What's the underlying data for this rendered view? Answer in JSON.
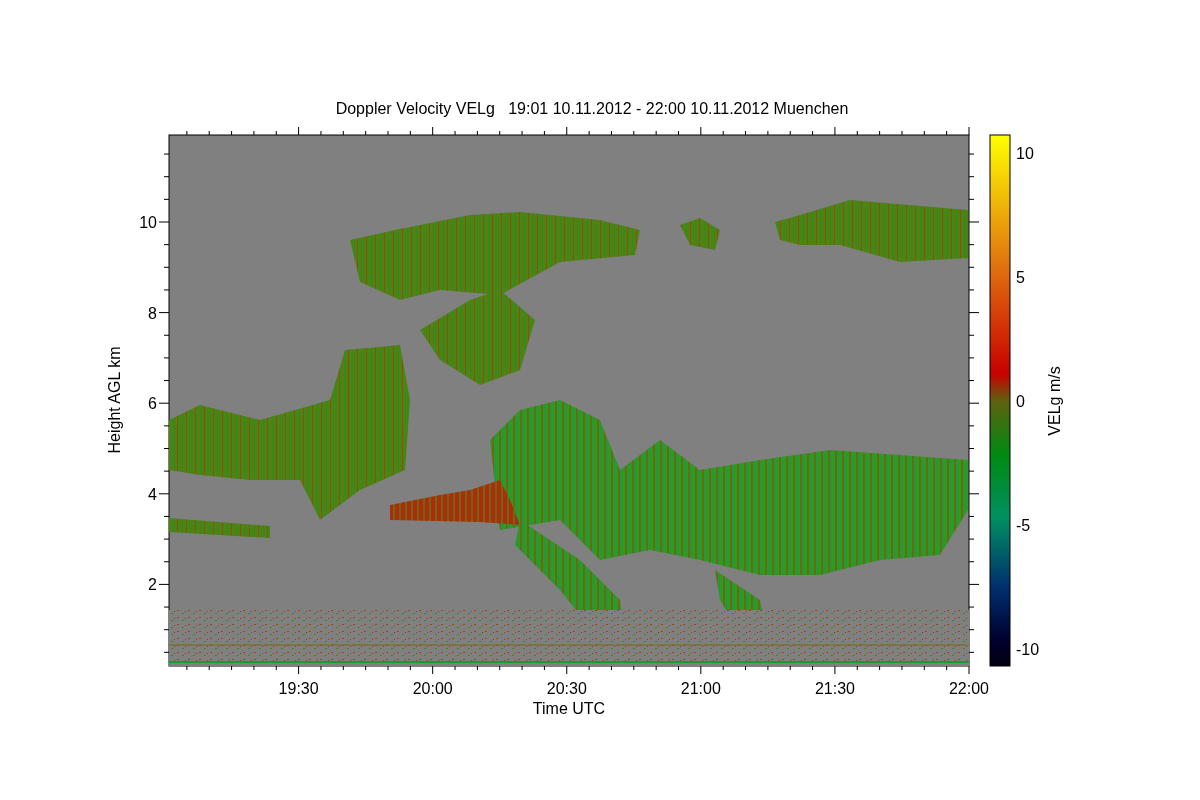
{
  "title": "Doppler Velocity VELg   19:01 10.11.2012 - 22:00 10.11.2012 Muenchen",
  "plot": {
    "xlabel": "Time UTC",
    "ylabel": "Height AGL km",
    "xticks": [
      "19:30",
      "20:00",
      "20:30",
      "21:00",
      "21:30",
      "22:00"
    ],
    "yticks": [
      "10",
      "8",
      "6",
      "4",
      "2"
    ]
  },
  "colorbar": {
    "label": "VELg m/s",
    "ticks": [
      "10",
      "5",
      "0",
      "-5",
      "-10"
    ]
  }
}
